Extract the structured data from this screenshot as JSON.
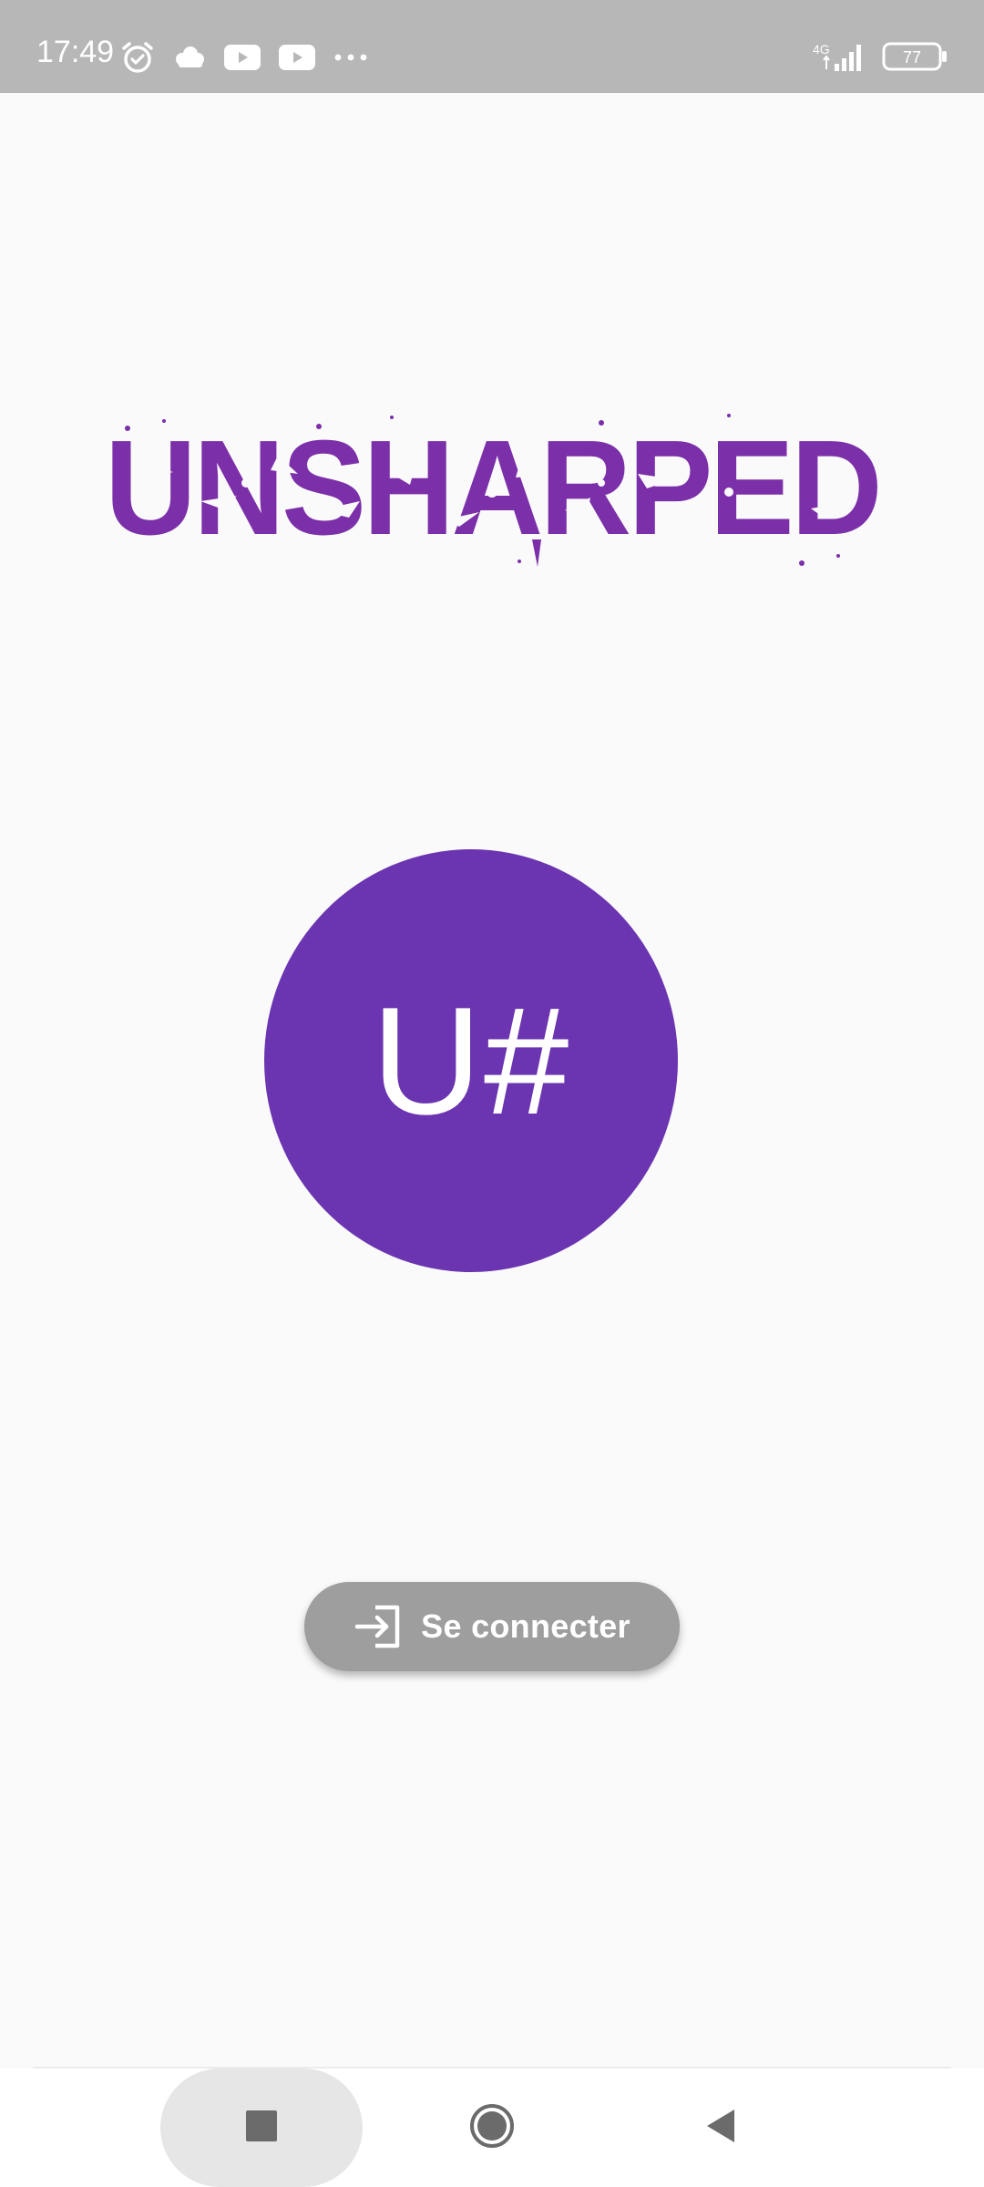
{
  "status_bar": {
    "time": "17:49",
    "left_icons": [
      "alarm-icon",
      "cloud-icon",
      "youtube-icon",
      "youtube-icon",
      "more-dots-icon"
    ],
    "network": "4G",
    "battery": "77"
  },
  "logo": {
    "text": "UNSHARPED",
    "color": "#7b2fa8"
  },
  "avatar": {
    "initials": "U#",
    "color": "#6b34b0"
  },
  "login_button": {
    "label": "Se connecter",
    "icon": "login-icon",
    "color": "#9e9e9e"
  },
  "nav_bar": {
    "buttons": [
      "recents-square-icon",
      "home-circle-icon",
      "back-triangle-icon"
    ]
  }
}
